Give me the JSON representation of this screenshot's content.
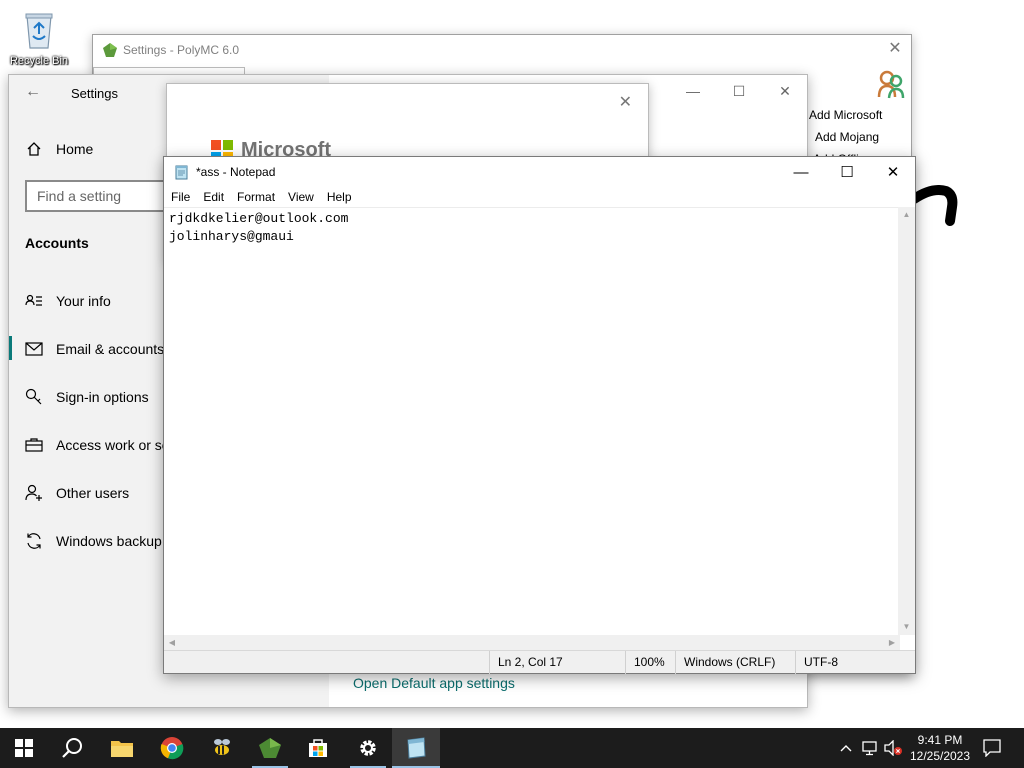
{
  "desktop": {
    "recycle_bin_label": "Recycle Bin"
  },
  "polymc": {
    "title": "Settings - PolyMC 6.0",
    "side_items": [
      "Add Microsoft",
      "Add Mojang",
      "Add Offline"
    ]
  },
  "settings": {
    "title": "Settings",
    "home_label": "Home",
    "search_placeholder": "Find a setting",
    "section_title": "Accounts",
    "nav": [
      {
        "label": "Your info",
        "icon": "person-card-icon"
      },
      {
        "label": "Email & accounts",
        "icon": "mail-icon",
        "active": true
      },
      {
        "label": "Sign-in options",
        "icon": "key-icon"
      },
      {
        "label": "Access work or school",
        "icon": "briefcase-icon"
      },
      {
        "label": "Other users",
        "icon": "person-add-icon"
      },
      {
        "label": "Windows backup",
        "icon": "sync-icon"
      }
    ],
    "default_app_link": "Open Default app settings"
  },
  "ms_dialog": {
    "brand": "Microsoft"
  },
  "notepad": {
    "title": "*ass - Notepad",
    "menu": [
      "File",
      "Edit",
      "Format",
      "View",
      "Help"
    ],
    "lines": [
      "rjdkdkelier@outlook.com",
      "jolinharys@gmaui"
    ],
    "status": {
      "position": "Ln 2, Col 17",
      "zoom": "100%",
      "line_ending": "Windows (CRLF)",
      "encoding": "UTF-8"
    }
  },
  "taskbar": {
    "apps": [
      "start-button",
      "search-button",
      "file-explorer",
      "chrome",
      "bee-app",
      "polymc",
      "microsoft-store",
      "settings",
      "notepad"
    ],
    "time": "9:41 PM",
    "date": "12/25/2023"
  },
  "colors": {
    "accent": "#0a7a7a",
    "taskbar": "#1c1c1c",
    "link": "#0a6d6d"
  }
}
